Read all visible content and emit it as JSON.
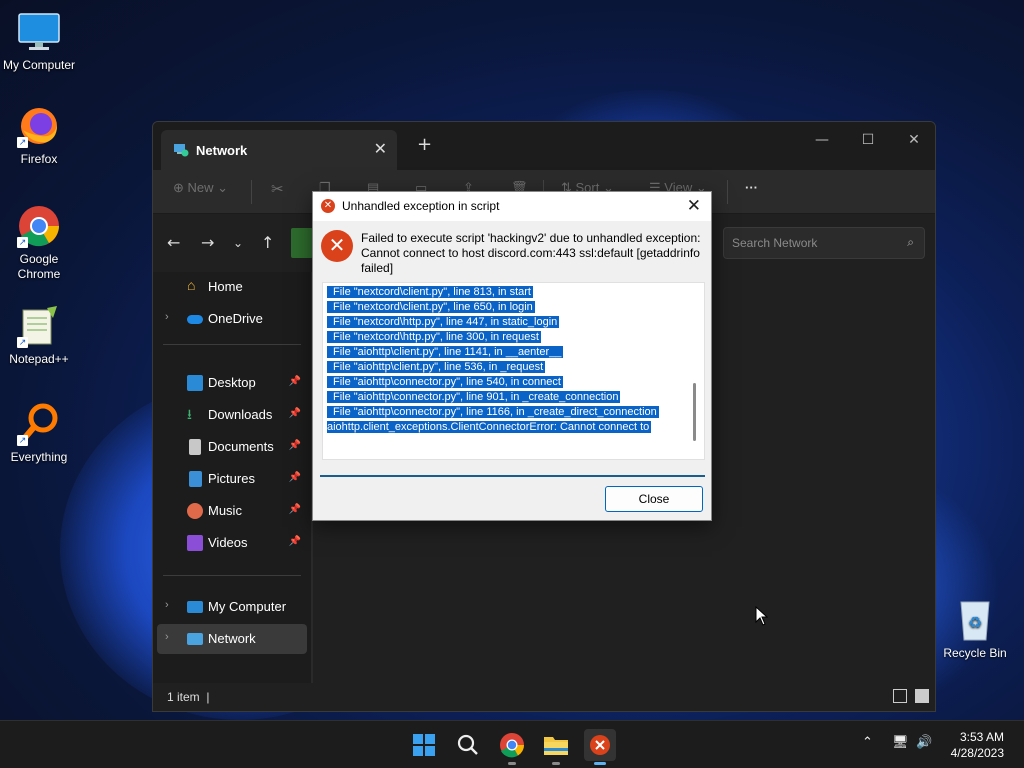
{
  "desktop": {
    "icons": [
      {
        "label": "My Computer"
      },
      {
        "label": "Firefox"
      },
      {
        "label": "Google Chrome"
      },
      {
        "label": "Notepad++"
      },
      {
        "label": "Everything"
      },
      {
        "label": "Recycle Bin"
      }
    ]
  },
  "explorer": {
    "tab_title": "Network",
    "toolbar": {
      "new_label": "New",
      "sort_label": "Sort",
      "view_label": "View",
      "more_label": "···"
    },
    "search_placeholder": "Search Network",
    "nav": {
      "top": [
        {
          "label": "Home"
        },
        {
          "label": "OneDrive"
        }
      ],
      "quick": [
        {
          "label": "Desktop"
        },
        {
          "label": "Downloads"
        },
        {
          "label": "Documents"
        },
        {
          "label": "Pictures"
        },
        {
          "label": "Music"
        },
        {
          "label": "Videos"
        }
      ],
      "bottom": [
        {
          "label": "My Computer"
        },
        {
          "label": "Network"
        }
      ]
    },
    "status_count": "1 item"
  },
  "dialog": {
    "title": "Unhandled exception in script",
    "message": "Failed to execute script 'hackingv2' due to unhandled exception: Cannot connect to host discord.com:443 ssl:default [getaddrinfo failed]",
    "trace": [
      "File \"nextcord\\client.py\", line 813, in start",
      "File \"nextcord\\client.py\", line 650, in login",
      "File \"nextcord\\http.py\", line 447, in static_login",
      "File \"nextcord\\http.py\", line 300, in request",
      "File \"aiohttp\\client.py\", line 1141, in __aenter__",
      "File \"aiohttp\\client.py\", line 536, in _request",
      "File \"aiohttp\\connector.py\", line 540, in connect",
      "File \"aiohttp\\connector.py\", line 901, in _create_connection",
      "File \"aiohttp\\connector.py\", line 1166, in _create_direct_connection",
      "aiohttp.client_exceptions.ClientConnectorError: Cannot connect to"
    ],
    "close_label": "Close"
  },
  "taskbar": {
    "time": "3:53 AM",
    "date": "4/28/2023"
  },
  "colors": {
    "accent": "#0067c0",
    "selection": "#0a64c8",
    "error": "#d9421b"
  }
}
